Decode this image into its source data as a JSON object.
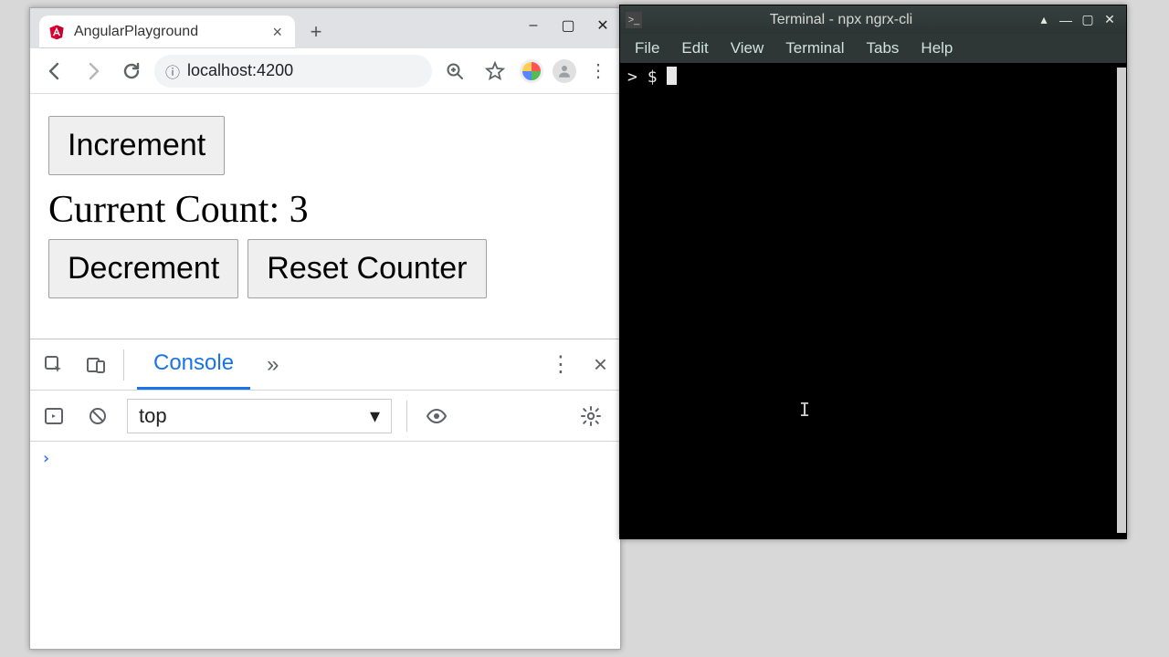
{
  "browser": {
    "tab_title": "AngularPlayground",
    "url": "localhost:4200",
    "url_host": "localhost",
    "url_port": ":4200",
    "win": {
      "min": "–",
      "max": "▢",
      "close": "✕"
    }
  },
  "app": {
    "increment_label": "Increment",
    "count_label_prefix": "Current Count: ",
    "count_value": "3",
    "decrement_label": "Decrement",
    "reset_label": "Reset Counter"
  },
  "devtools": {
    "tab_console": "Console",
    "context": "top"
  },
  "terminal": {
    "title": "Terminal - npx ngrx-cli",
    "menu": [
      "File",
      "Edit",
      "View",
      "Terminal",
      "Tabs",
      "Help"
    ],
    "prompt_prefix": "> ",
    "prompt": "$"
  }
}
